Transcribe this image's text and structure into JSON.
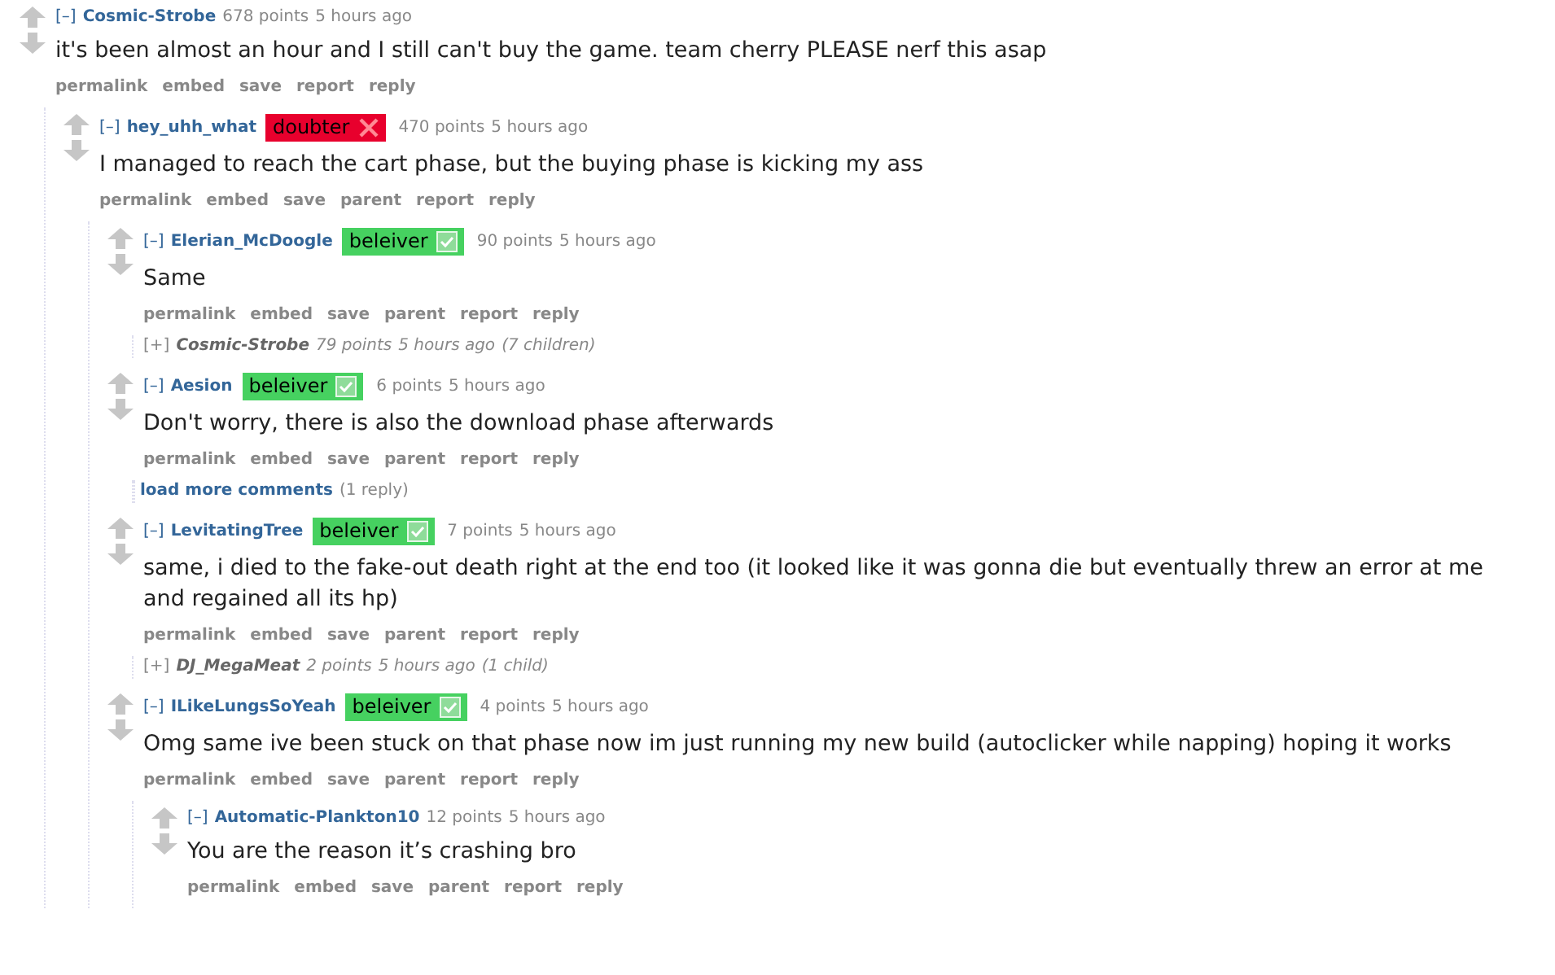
{
  "comments": [
    {
      "kind": "comment",
      "toggle": "[–]",
      "author": "Cosmic-Strobe",
      "score": "678 points",
      "time": "5 hours ago",
      "body": "it's been almost an hour and I still can't buy the game. team cherry PLEASE nerf this asap",
      "actions": [
        "permalink",
        "embed",
        "save",
        "report",
        "reply"
      ],
      "children": [
        {
          "kind": "comment",
          "toggle": "[–]",
          "author": "hey_uhh_what",
          "flair": {
            "text": "doubter",
            "kind": "cross",
            "color": "#e8002d"
          },
          "score": "470 points",
          "time": "5 hours ago",
          "body": "I managed to reach the cart phase, but the buying phase is kicking my ass",
          "actions": [
            "permalink",
            "embed",
            "save",
            "parent",
            "report",
            "reply"
          ],
          "children": [
            {
              "kind": "comment",
              "toggle": "[–]",
              "author": "Elerian_McDoogle",
              "flair": {
                "text": "beleiver",
                "kind": "check",
                "color": "#46d160"
              },
              "score": "90 points",
              "time": "5 hours ago",
              "body": "Same",
              "actions": [
                "permalink",
                "embed",
                "save",
                "parent",
                "report",
                "reply"
              ],
              "children": [
                {
                  "kind": "collapsed",
                  "toggle": "[+]",
                  "author": "Cosmic-Strobe",
                  "score": "79 points",
                  "time": "5 hours ago",
                  "count": "(7 children)"
                }
              ]
            },
            {
              "kind": "comment",
              "toggle": "[–]",
              "author": "Aesion",
              "flair": {
                "text": "beleiver",
                "kind": "check",
                "color": "#46d160"
              },
              "score": "6 points",
              "time": "5 hours ago",
              "body": "Don't worry, there is also the download phase afterwards",
              "actions": [
                "permalink",
                "embed",
                "save",
                "parent",
                "report",
                "reply"
              ],
              "children": [
                {
                  "kind": "more",
                  "link": "load more comments",
                  "count": "(1 reply)"
                }
              ]
            },
            {
              "kind": "comment",
              "toggle": "[–]",
              "author": "LevitatingTree",
              "flair": {
                "text": "beleiver",
                "kind": "check",
                "color": "#46d160"
              },
              "score": "7 points",
              "time": "5 hours ago",
              "body": "same, i died to the fake-out death right at the end too (it looked like it was gonna die but eventually threw an error at me and regained all its hp)",
              "actions": [
                "permalink",
                "embed",
                "save",
                "parent",
                "report",
                "reply"
              ],
              "children": [
                {
                  "kind": "collapsed",
                  "toggle": "[+]",
                  "author": "DJ_MegaMeat",
                  "score": "2 points",
                  "time": "5 hours ago",
                  "count": "(1 child)"
                }
              ]
            },
            {
              "kind": "comment",
              "toggle": "[–]",
              "author": "ILikeLungsSoYeah",
              "flair": {
                "text": "beleiver",
                "kind": "check",
                "color": "#46d160"
              },
              "score": "4 points",
              "time": "5 hours ago",
              "body": "Omg same ive been stuck on that phase now im just running my new build (autoclicker while napping) hoping it works",
              "actions": [
                "permalink",
                "embed",
                "save",
                "parent",
                "report",
                "reply"
              ],
              "children": [
                {
                  "kind": "comment",
                  "toggle": "[–]",
                  "author": "Automatic-Plankton10",
                  "score": "12 points",
                  "time": "5 hours ago",
                  "body": "You are the reason it’s crashing bro",
                  "actions": [
                    "permalink",
                    "embed",
                    "save",
                    "parent",
                    "report",
                    "reply"
                  ]
                }
              ]
            }
          ]
        }
      ]
    }
  ]
}
